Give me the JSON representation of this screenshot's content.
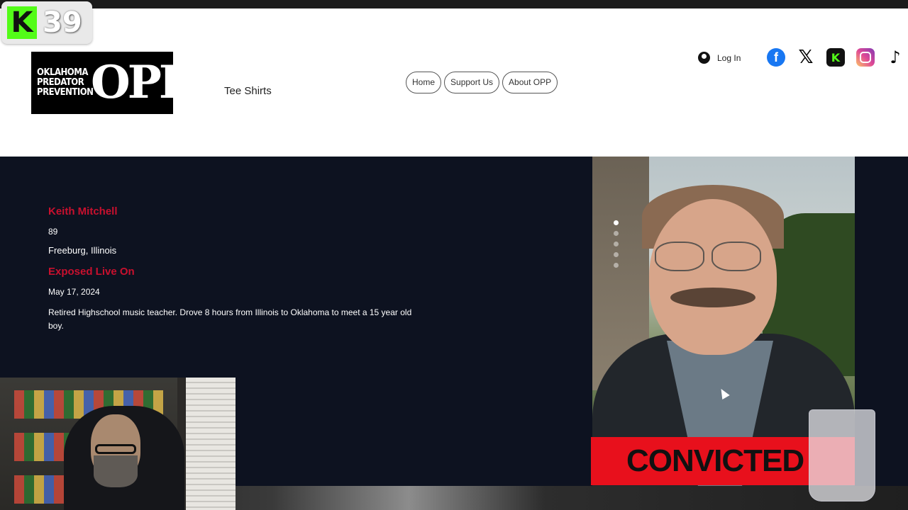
{
  "overlay": {
    "kick_letter": "K",
    "viewer_count": "39"
  },
  "header": {
    "logo_small_text": "OKLAHOMA PREDATOR PREVENTION",
    "logo_big_text": "OPP",
    "tee_shirts_link": "Tee Shirts",
    "nav": [
      {
        "label": "Home"
      },
      {
        "label": "Support Us"
      },
      {
        "label": "About OPP"
      }
    ],
    "login_label": "Log In",
    "socials": [
      "facebook-icon",
      "x-icon",
      "kick-icon",
      "instagram-icon",
      "tiktok-icon"
    ]
  },
  "profile": {
    "name": "Keith Mitchell",
    "age": "89",
    "location": "Freeburg, Illinois",
    "exposed_label": "Exposed Live On",
    "date": "May 17, 2024",
    "description": "Retired Highschool music teacher. Drove 8 hours from Illinois to Oklahoma to meet a 15 year old boy.",
    "status_banner": "CONVICTED"
  },
  "colors": {
    "accent_red": "#c8102e",
    "hero_bg": "#0d1220",
    "banner_red": "#e8101c",
    "kick_green": "#53fc18"
  }
}
